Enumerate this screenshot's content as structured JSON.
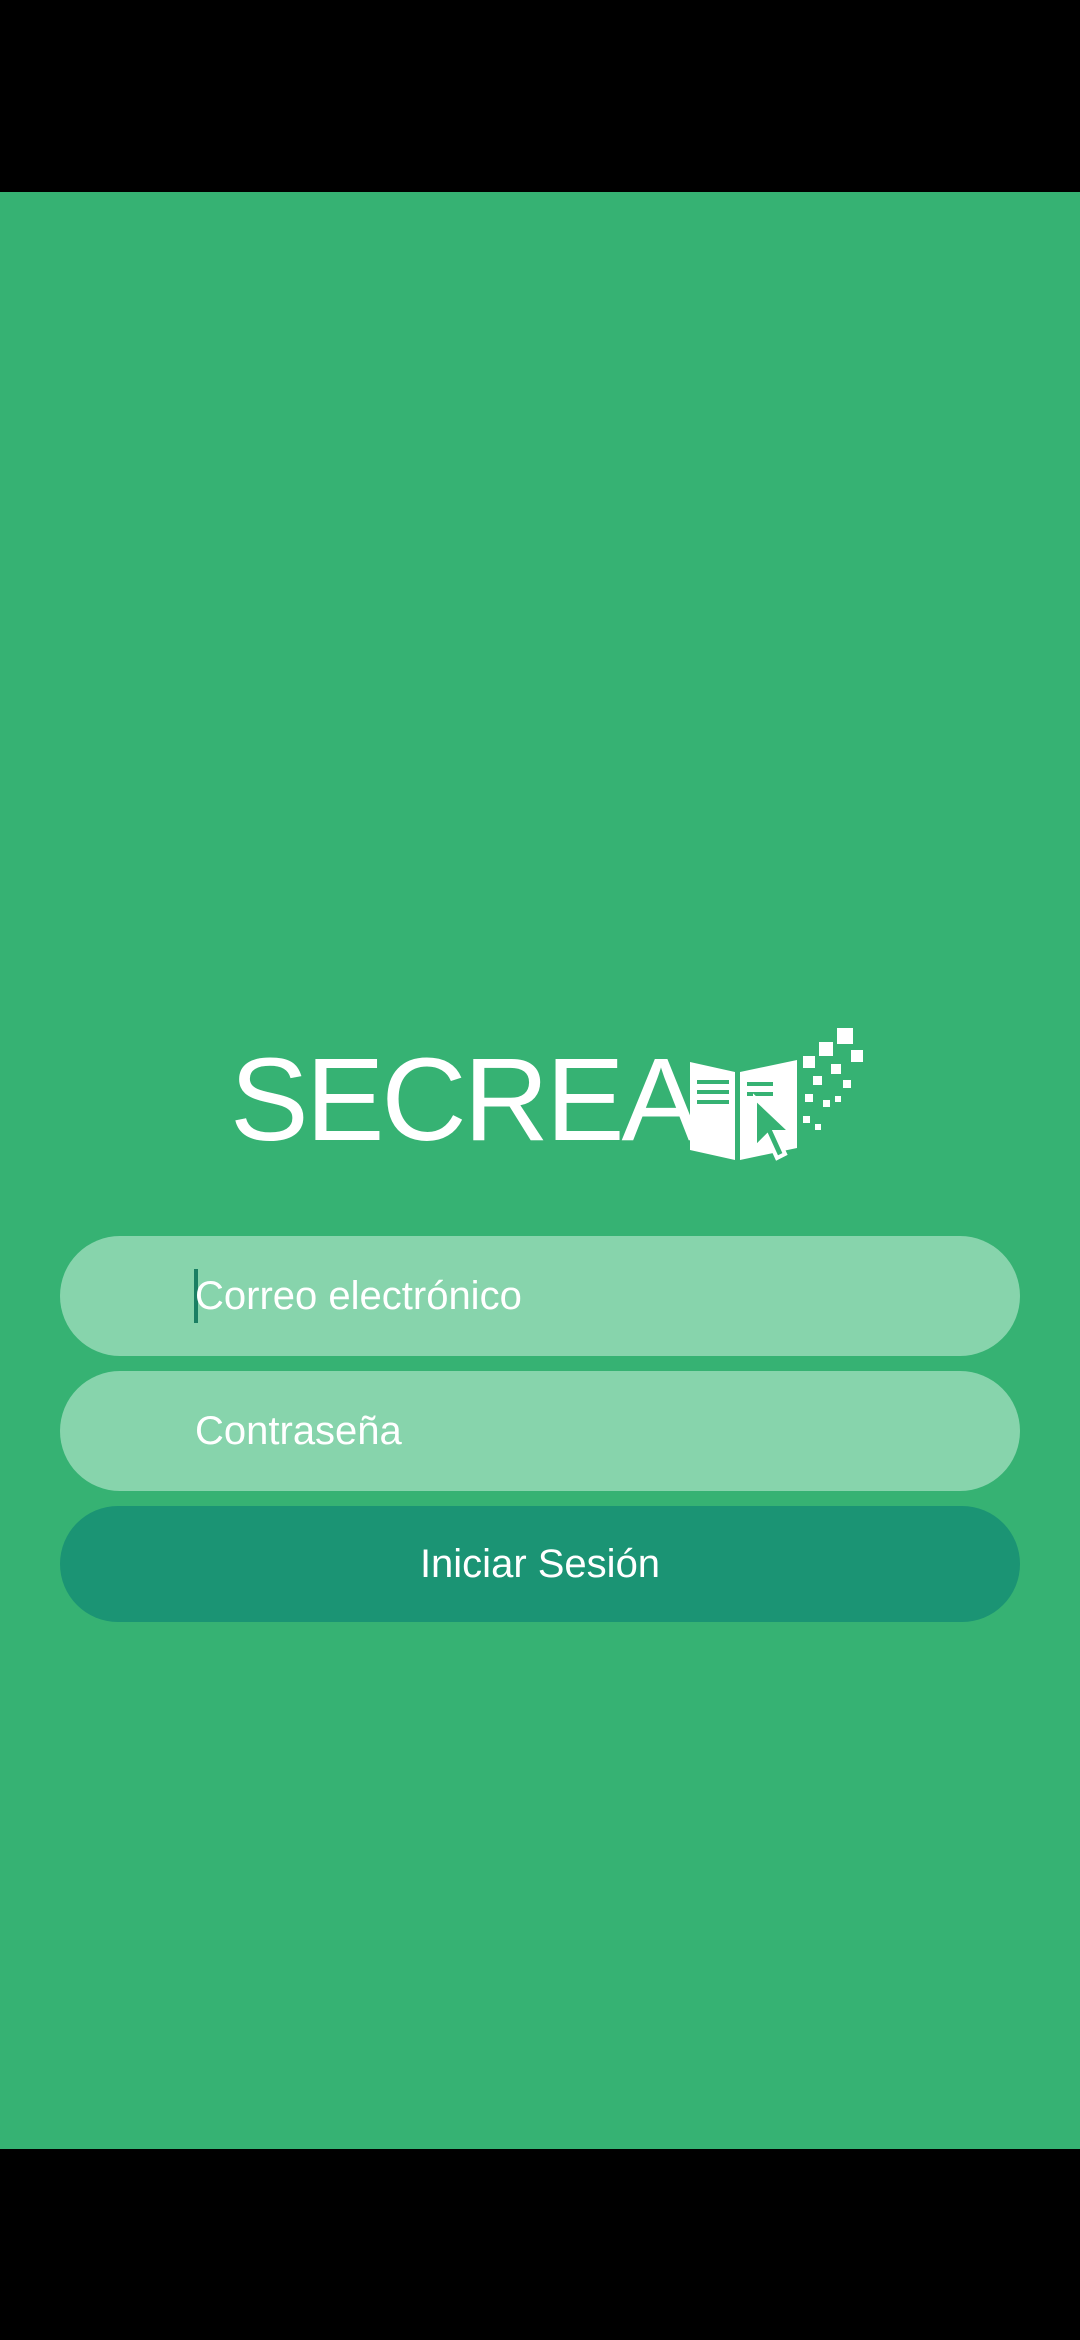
{
  "app": {
    "logo_text": "SECREA",
    "background_color": "#36b273"
  },
  "form": {
    "email_placeholder": "Correo electrónico",
    "password_placeholder": "Contraseña",
    "login_label": "Iniciar Sesión",
    "field_color": "#87d4ac",
    "button_color": "#1b9474"
  }
}
